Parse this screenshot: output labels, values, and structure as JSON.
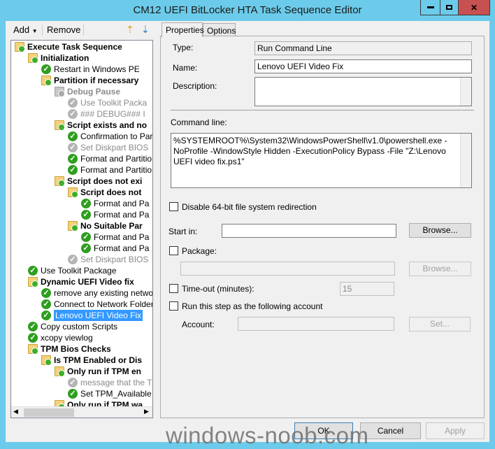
{
  "window": {
    "title": "CM12 UEFI BitLocker HTA Task Sequence Editor",
    "frame_color": "#6ccbea",
    "close_color": "#c75050"
  },
  "toolbar": {
    "add": "Add",
    "remove": "Remove"
  },
  "tree": [
    {
      "label": "Execute Task Sequence",
      "level": 0,
      "icon": "folder",
      "bold": true
    },
    {
      "label": "Initialization",
      "level": 1,
      "icon": "folder",
      "bold": true
    },
    {
      "label": "Restart in Windows PE",
      "level": 2,
      "icon": "check"
    },
    {
      "label": "Partition if necessary",
      "level": 2,
      "icon": "folder",
      "bold": true
    },
    {
      "label": "Debug Pause",
      "level": 3,
      "icon": "folder",
      "bold": true,
      "disabled": true
    },
    {
      "label": "Use Toolkit Packa",
      "level": 4,
      "icon": "check",
      "disabled": true
    },
    {
      "label": "### DEBUG### I",
      "level": 4,
      "icon": "check",
      "disabled": true
    },
    {
      "label": "Script exists and no",
      "level": 3,
      "icon": "folder",
      "bold": true
    },
    {
      "label": "Confirmation to Par",
      "level": 4,
      "icon": "check"
    },
    {
      "label": "Set Diskpart BIOS",
      "level": 4,
      "icon": "check",
      "disabled": true
    },
    {
      "label": "Format and Partitio",
      "level": 4,
      "icon": "check"
    },
    {
      "label": "Format and Partitio",
      "level": 4,
      "icon": "check"
    },
    {
      "label": "Script does not exi",
      "level": 3,
      "icon": "folder",
      "bold": true
    },
    {
      "label": "Script does not",
      "level": 4,
      "icon": "folder",
      "bold": true
    },
    {
      "label": "Format and Pa",
      "level": 5,
      "icon": "check"
    },
    {
      "label": "Format and Pa",
      "level": 5,
      "icon": "check"
    },
    {
      "label": "No Suitable Par",
      "level": 4,
      "icon": "folder",
      "bold": true
    },
    {
      "label": "Format and Pa",
      "level": 5,
      "icon": "check"
    },
    {
      "label": "Format and Pa",
      "level": 5,
      "icon": "check"
    },
    {
      "label": "Set Diskpart BIOS",
      "level": 4,
      "icon": "check",
      "disabled": true
    },
    {
      "label": "Use Toolkit Package",
      "level": 1,
      "icon": "check"
    },
    {
      "label": "Dynamic UEFI Video fix",
      "level": 1,
      "icon": "folder",
      "bold": true
    },
    {
      "label": "remove any existing netwo",
      "level": 2,
      "icon": "check"
    },
    {
      "label": "Connect to Network Folder",
      "level": 2,
      "icon": "check"
    },
    {
      "label": "Lenovo UEFI Video Fix",
      "level": 2,
      "icon": "check",
      "selected": true
    },
    {
      "label": "Copy custom Scripts",
      "level": 1,
      "icon": "check"
    },
    {
      "label": "xcopy viewlog",
      "level": 1,
      "icon": "check"
    },
    {
      "label": "TPM Bios Checks",
      "level": 1,
      "icon": "folder",
      "bold": true
    },
    {
      "label": "Is TPM Enabled or Dis",
      "level": 2,
      "icon": "folder",
      "bold": true
    },
    {
      "label": "Only run if TPM en",
      "level": 3,
      "icon": "folder",
      "bold": true
    },
    {
      "label": "message that the T",
      "level": 4,
      "icon": "check",
      "disabled": true
    },
    {
      "label": "Set TPM_Available",
      "level": 4,
      "icon": "check"
    },
    {
      "label": "Only run if TPM wa",
      "level": 3,
      "icon": "folder",
      "bold": true
    }
  ],
  "tabs": [
    "Properties",
    "Options"
  ],
  "props": {
    "type_label": "Type:",
    "type_value": "Run Command Line",
    "name_label": "Name:",
    "name_value": "Lenovo UEFI Video Fix",
    "desc_label": "Description:",
    "desc_value": "",
    "cmd_label": "Command line:",
    "cmd_value": "%SYSTEMROOT%\\System32\\WindowsPowerShell\\v1.0\\powershell.exe -NoProfile -WindowStyle Hidden -ExecutionPolicy Bypass -File \"Z:\\Lenovo UEFI video fix.ps1\"",
    "disable64": "Disable 64-bit file system redirection",
    "startin_label": "Start in:",
    "startin_value": "",
    "browse": "Browse...",
    "package_label": "Package:",
    "package_value": "",
    "timeout_label": "Time-out (minutes):",
    "timeout_value": "15",
    "runas_label": "Run this step as the following account",
    "account_label": "Account:",
    "account_value": "",
    "set": "Set..."
  },
  "buttons": {
    "ok": "OK",
    "cancel": "Cancel",
    "apply": "Apply"
  },
  "watermark": "windows-noob.com"
}
